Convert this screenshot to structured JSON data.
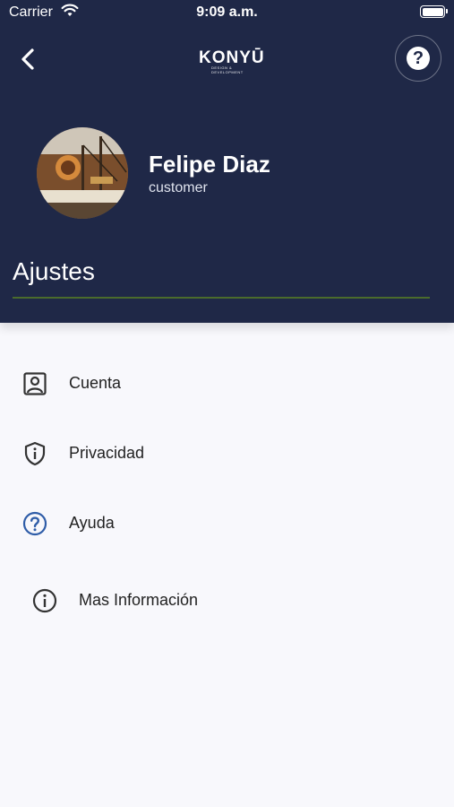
{
  "status_bar": {
    "carrier": "Carrier",
    "time": "9:09 a.m."
  },
  "header": {
    "logo_text": "KONYŪ",
    "logo_subtext": "DESIGN & DEVELOPMENT",
    "help_symbol": "?",
    "user_name": "Felipe Diaz",
    "user_role": "customer",
    "section_title": "Ajustes"
  },
  "menu": {
    "items": [
      {
        "label": "Cuenta",
        "icon": "account-box-icon"
      },
      {
        "label": "Privacidad",
        "icon": "shield-info-icon"
      },
      {
        "label": "Ayuda",
        "icon": "help-circle-icon"
      },
      {
        "label": "Mas Información",
        "icon": "info-circle-icon"
      }
    ]
  },
  "colors": {
    "header_bg": "#1f2847",
    "accent_line": "#4a6b2c",
    "help_icon": "#2f5da8",
    "page_bg": "#f8f8fc"
  }
}
